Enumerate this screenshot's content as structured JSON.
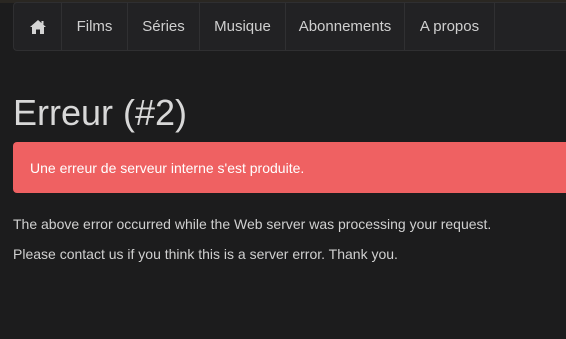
{
  "nav": {
    "home_icon": "home-icon",
    "items": [
      {
        "label": "Films"
      },
      {
        "label": "Séries"
      },
      {
        "label": "Musique"
      },
      {
        "label": "Abonnements"
      },
      {
        "label": "A propos"
      }
    ]
  },
  "page": {
    "title": "Erreur (#2)",
    "alert_message": "Une erreur de serveur interne s'est produite.",
    "paragraphs": [
      "The above error occurred while the Web server was processing your request.",
      "Please contact us if you think this is a server error. Thank you."
    ]
  },
  "colors": {
    "background": "#1c1c1d",
    "navbar": "#222224",
    "alert": "#ef6162"
  }
}
